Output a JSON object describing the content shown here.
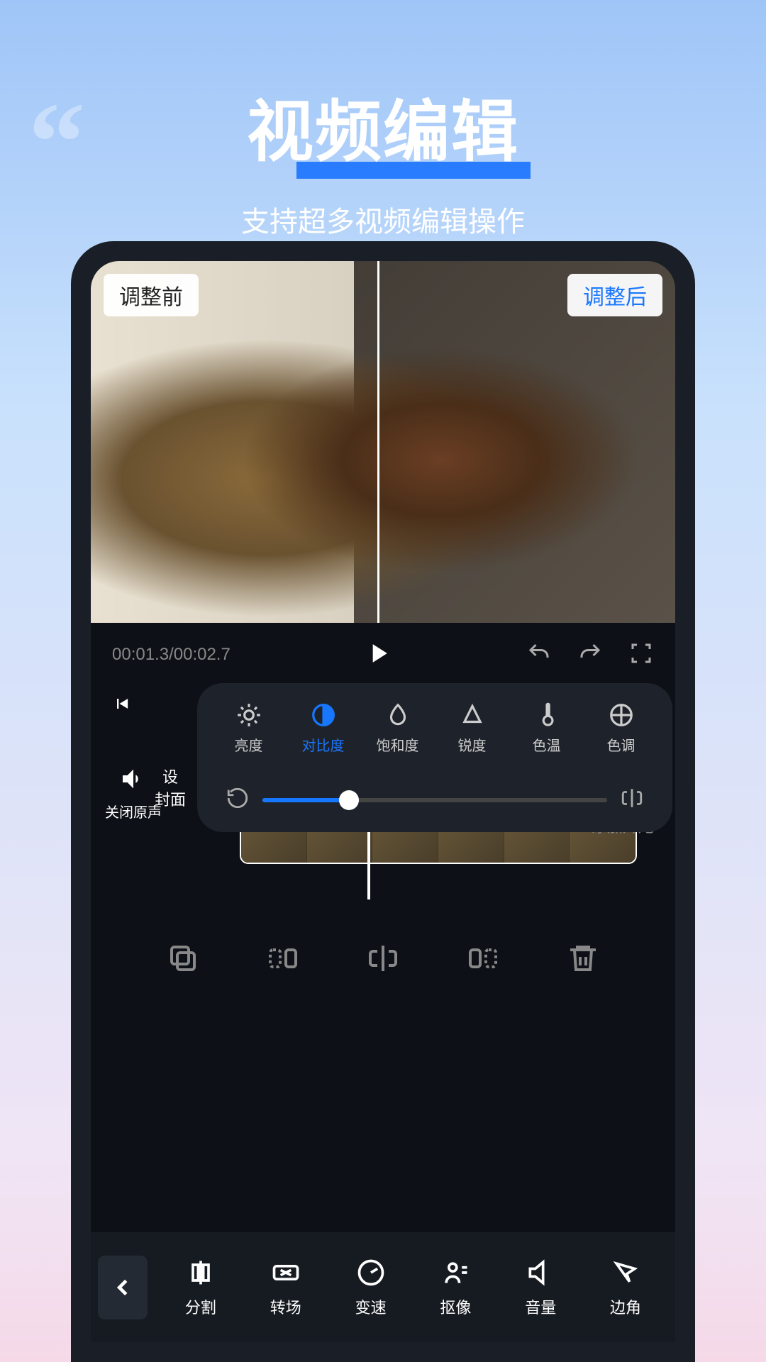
{
  "header": {
    "title": "视频编辑",
    "subtitle": "支持超多视频编辑操作"
  },
  "preview": {
    "before_label": "调整前",
    "after_label": "调整后"
  },
  "playback": {
    "current_time": "00:01.3",
    "total_time": "00:02.7"
  },
  "timeline": {
    "mute_label": "关闭原声",
    "cover_line1": "设",
    "cover_line2": "封面",
    "add_tail": "+ 添加片尾"
  },
  "adjust": {
    "items": [
      {
        "label": "亮度"
      },
      {
        "label": "对比度"
      },
      {
        "label": "饱和度"
      },
      {
        "label": "锐度"
      },
      {
        "label": "色温"
      },
      {
        "label": "色调"
      }
    ]
  },
  "bottom_tools": [
    {
      "label": "分割"
    },
    {
      "label": "转场"
    },
    {
      "label": "变速"
    },
    {
      "label": "抠像"
    },
    {
      "label": "音量"
    },
    {
      "label": "边角"
    }
  ]
}
